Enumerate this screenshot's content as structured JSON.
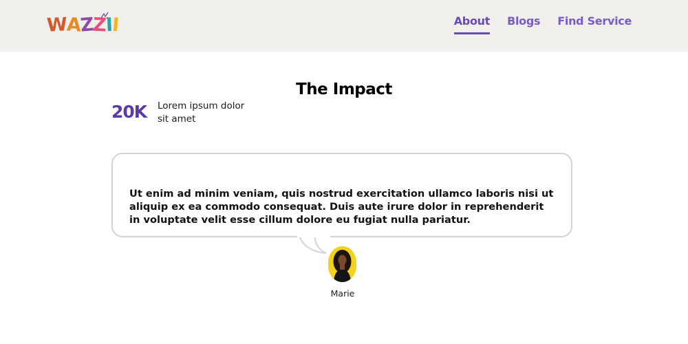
{
  "brand": {
    "logo_text": "WAZZII",
    "logo_letters": [
      "W",
      "A",
      "Z",
      "Z",
      "I",
      "I"
    ]
  },
  "nav": {
    "items": [
      {
        "label": "About",
        "active": true
      },
      {
        "label": "Blogs",
        "active": false
      },
      {
        "label": "Find Service",
        "active": false
      }
    ]
  },
  "impact": {
    "title": "The Impact",
    "stat_value": "20K",
    "stat_label": "Lorem ipsum dolor sit amet"
  },
  "testimonial": {
    "quote": "Ut enim ad minim veniam, quis nostrud exercitation ullamco laboris nisi ut aliquip ex ea commodo consequat. Duis aute irure dolor in reprehenderit in voluptate velit esse cillum dolore eu fugiat nulla pariatur.",
    "author": "Marie"
  },
  "colors": {
    "header_bg": "#f1efeb",
    "accent_purple": "#6a49b8",
    "stat_purple": "#5b3aa6",
    "avatar_bg": "#f3d21c",
    "card_border": "#d4d4d4"
  }
}
